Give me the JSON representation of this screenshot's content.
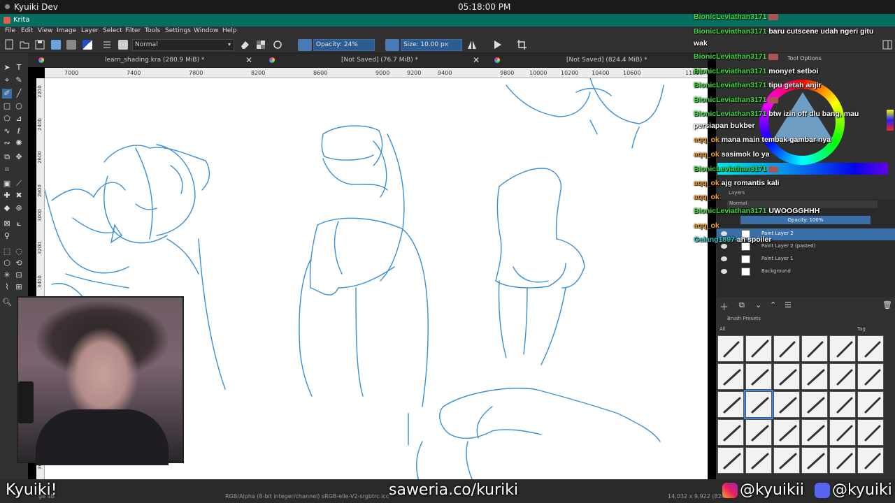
{
  "system_bar": {
    "title": "Kyuiki Dev",
    "clock": "05:18:00 PM"
  },
  "window": {
    "title": "Krita"
  },
  "menu": [
    "File",
    "Edit",
    "View",
    "Image",
    "Layer",
    "Select",
    "Filter",
    "Tools",
    "Settings",
    "Window",
    "Help"
  ],
  "toolbar": {
    "blend_mode": "Normal",
    "opacity_label": "Opacity: 24%",
    "size_label": "Size: 10.00 px"
  },
  "tabs": [
    {
      "label": "learn_shading.kra (280.9 MiB) *"
    },
    {
      "label": "[Not Saved] (76.7 MiB) *"
    },
    {
      "label": "[Not Saved] (824.4 MiB) *"
    }
  ],
  "ruler": {
    "top_ticks": [
      "7000",
      "7400",
      "7800",
      "8200",
      "8600",
      "9000",
      "9200",
      "9400",
      "9800",
      "10000",
      "10200",
      "10400",
      "10600",
      "11000"
    ],
    "left_ticks": [
      "2200",
      "2400",
      "2600",
      "2800",
      "3000",
      "3200",
      "3400",
      "3600"
    ]
  },
  "dock": {
    "tool_options_label": "Tool Options",
    "layers_label": "Layers",
    "layer_blend": "Normal",
    "layer_opacity": "Opacity: 100%",
    "layers": [
      {
        "name": "Paint Layer 2",
        "active": true
      },
      {
        "name": "Paint Layer 2 (pasted)",
        "active": false
      },
      {
        "name": "Paint Layer 1",
        "active": false
      },
      {
        "name": "Background",
        "active": false
      }
    ],
    "brush_presets_label": "Brush Presets",
    "brush_filter": "All",
    "brush_tag": "Tag"
  },
  "chat": [
    {
      "user": "BionicLeviathan3171",
      "color": "green",
      "message": "",
      "emote": true
    },
    {
      "user": "BionicLeviathan3171",
      "color": "green",
      "message": "baru cutscene udah ngeri gitu"
    },
    {
      "user": "",
      "color": "green",
      "message": "wak"
    },
    {
      "user": "BionicLeviathan3171",
      "color": "green",
      "message": "",
      "emote": true
    },
    {
      "user": "BionicLeviathan3171",
      "color": "green",
      "message": "monyet setboi"
    },
    {
      "user": "BionicLeviathan3171",
      "color": "green",
      "message": "tipu getah anjir"
    },
    {
      "user": "BionicLeviathan3171",
      "color": "green",
      "message": "",
      "emote": true
    },
    {
      "user": "BionicLeviathan3171",
      "color": "green",
      "message": "btw izin off dlu bang, mau"
    },
    {
      "user": "",
      "color": "green",
      "message": "persiapan bukber"
    },
    {
      "user": "aqq_ok",
      "color": "orange",
      "message": "mana main tembak gambar nya"
    },
    {
      "user": "aqq_ok",
      "color": "orange",
      "message": "sasimok lo ya"
    },
    {
      "user": "BionicLeviathan3171",
      "color": "green",
      "message": "",
      "emote": true
    },
    {
      "user": "aqq_ok",
      "color": "orange",
      "message": "ajg romantis kali"
    },
    {
      "user": "aqq_ok",
      "color": "orange",
      "message": ""
    },
    {
      "user": "BionicLeviathan3171",
      "color": "green",
      "message": "UWOOGGHHH"
    },
    {
      "user": "aqq_ok",
      "color": "orange",
      "message": ""
    },
    {
      "user": "Galang1897",
      "color": "cyan",
      "message": "ah spoiler"
    }
  ],
  "statusbar": {
    "left": "ge 4B",
    "middle": "RGB/Alpha (8-bit integer/channel)  sRGB-elle-V2-srgbtrc.icc",
    "right": "14,032 x 9,922 (824"
  },
  "overlay": {
    "streamer": "Kyuiki!",
    "saweria": "saweria.co/kuriki",
    "instagram": "@kyuikii",
    "discord": "@kyuiki"
  }
}
